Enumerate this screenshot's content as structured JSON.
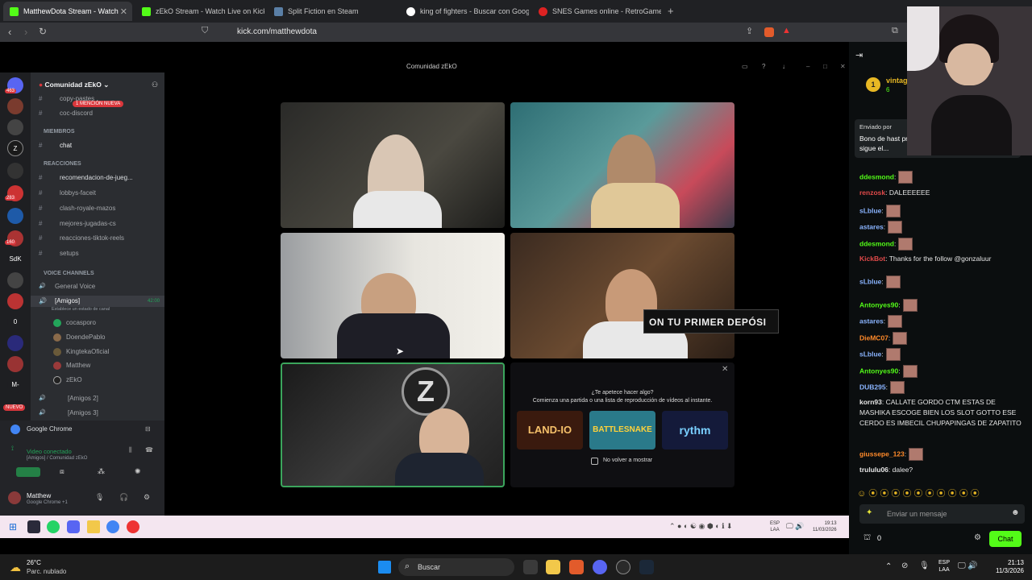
{
  "browser": {
    "tabs": [
      {
        "label": "MatthewDota Stream - Watch",
        "color": "#53fc18",
        "active": true
      },
      {
        "label": "zEkO Stream - Watch Live on Kick",
        "color": "#53fc18"
      },
      {
        "label": "Split Fiction en Steam",
        "color": "#1b2838"
      },
      {
        "label": "king of fighters - Buscar con Google",
        "color": "#4285f4"
      },
      {
        "label": "SNES Games online - RetroGames.cc",
        "color": "#d22"
      }
    ],
    "url": "kick.com/matthewdota"
  },
  "discord": {
    "window_title": "Comunidad zEkO",
    "server_name": "Comunidad zEkO",
    "mention_badge": "1 MENCIÓN NUEVA",
    "channels_top": [
      "copy-pastes",
      "coc-discord"
    ],
    "cat_members": "MIEMBROS",
    "chat_channel": "chat",
    "cat_reactions": "REACCIONES",
    "reaction_channels": [
      "recomendacion-de-jueg...",
      "lobbys-faceit",
      "clash-royale-mazos",
      "mejores-jugadas-cs",
      "reacciones-tiktok-reels",
      "setups"
    ],
    "cat_voice": "VOICE CHANNELS",
    "voice_general": "General Voice",
    "voice_amigos": "[Amigos]",
    "voice_amigos_sub": "Establece un estado de canal",
    "voice_time": "42:00",
    "voice_members": [
      "cocasporo",
      "DoendePablo",
      "KingtekaOficial",
      "Matthew",
      "zEkO"
    ],
    "voice_amigos2": "[Amigos 2]",
    "voice_amigos3": "[Amigos 3]",
    "activity_app": "Google Chrome",
    "video_connected": "Video conectado",
    "video_connected_sub": "[Amigos] / Comunidad zEkO",
    "user_name": "Matthew",
    "user_status": "Google Chrome +1",
    "server_badges": [
      "463",
      "283",
      "160",
      "SdK",
      "0",
      "M-"
    ],
    "new_label": "NUEVO"
  },
  "overlay_text": "ON TU PRIMER DEPÓSI",
  "promo": {
    "title": "¿Te apetece hacer algo?",
    "subtitle": "Comienza una partida o una lista de reproducción de vídeos al instante.",
    "games": [
      "LAND-IO",
      "BATTLESNAKE",
      "rythm"
    ],
    "checkbox": "No volver a mostrar"
  },
  "chat": {
    "header_user": "vintag",
    "header_count": "6",
    "pinned_by": "Enviado por",
    "pinned_text": "Bono de hast promocional GOTTO1X si sigue el...",
    "messages": [
      {
        "user": "ddesmond",
        "text": "",
        "color": "#53fc18",
        "emote": true
      },
      {
        "user": "renzosk",
        "text": ": DALEEEEEE",
        "color": "#e14a4a",
        "emote": false
      },
      {
        "user": "sLblue",
        "text": "",
        "color": "#8ab4ff",
        "emote": true
      },
      {
        "user": "astares",
        "text": "",
        "color": "#8ab4ff",
        "emote": true
      },
      {
        "user": "ddesmond",
        "text": "",
        "color": "#53fc18",
        "emote": true
      },
      {
        "user": "KickBot",
        "text": ": Thanks for the follow @gonzaluur",
        "color": "#e14a4a",
        "emote": false
      },
      {
        "user": "sLblue",
        "text": "",
        "color": "#8ab4ff",
        "emote": true
      },
      {
        "user": "Antonyes90",
        "text": "",
        "color": "#53fc18",
        "emote": true
      },
      {
        "user": "astares",
        "text": "",
        "color": "#8ab4ff",
        "emote": true
      },
      {
        "user": "DieMC07",
        "text": "",
        "color": "#ff8a2a",
        "emote": true
      },
      {
        "user": "sLblue",
        "text": "",
        "color": "#8ab4ff",
        "emote": true
      },
      {
        "user": "Antonyes90",
        "text": "",
        "color": "#53fc18",
        "emote": true
      },
      {
        "user": "DUB295",
        "text": "",
        "color": "#8ab4ff",
        "emote": true
      },
      {
        "user": "korn93",
        "text": ": CALLATE GORDO CTM ESTAS DE MASHIKA ESCOGE BIEN LOS SLOT GOTTO ESE CERDO ES IMBECIL CHUPAPINGAS DE ZAPATITO",
        "color": "#e6e6e6",
        "emote": false
      },
      {
        "user": "giussepe_123",
        "text": "",
        "color": "#ff8a2a",
        "emote": true
      },
      {
        "user": "trululu06",
        "text": ": dalee?",
        "color": "#e6e6e6",
        "emote": false
      }
    ],
    "input_placeholder": "Enviar un mensaje",
    "points": "0",
    "send_label": "Chat"
  },
  "inner_taskbar": {
    "lang": "ESP",
    "lang2": "LAA",
    "time": "19:13",
    "date": "11/03/2026"
  },
  "taskbar": {
    "weather_temp": "26°C",
    "weather_desc": "Parc. nublado",
    "search": "Buscar",
    "lang": "ESP",
    "lang2": "LAA",
    "time": "21:13",
    "date": "11/3/2026"
  }
}
